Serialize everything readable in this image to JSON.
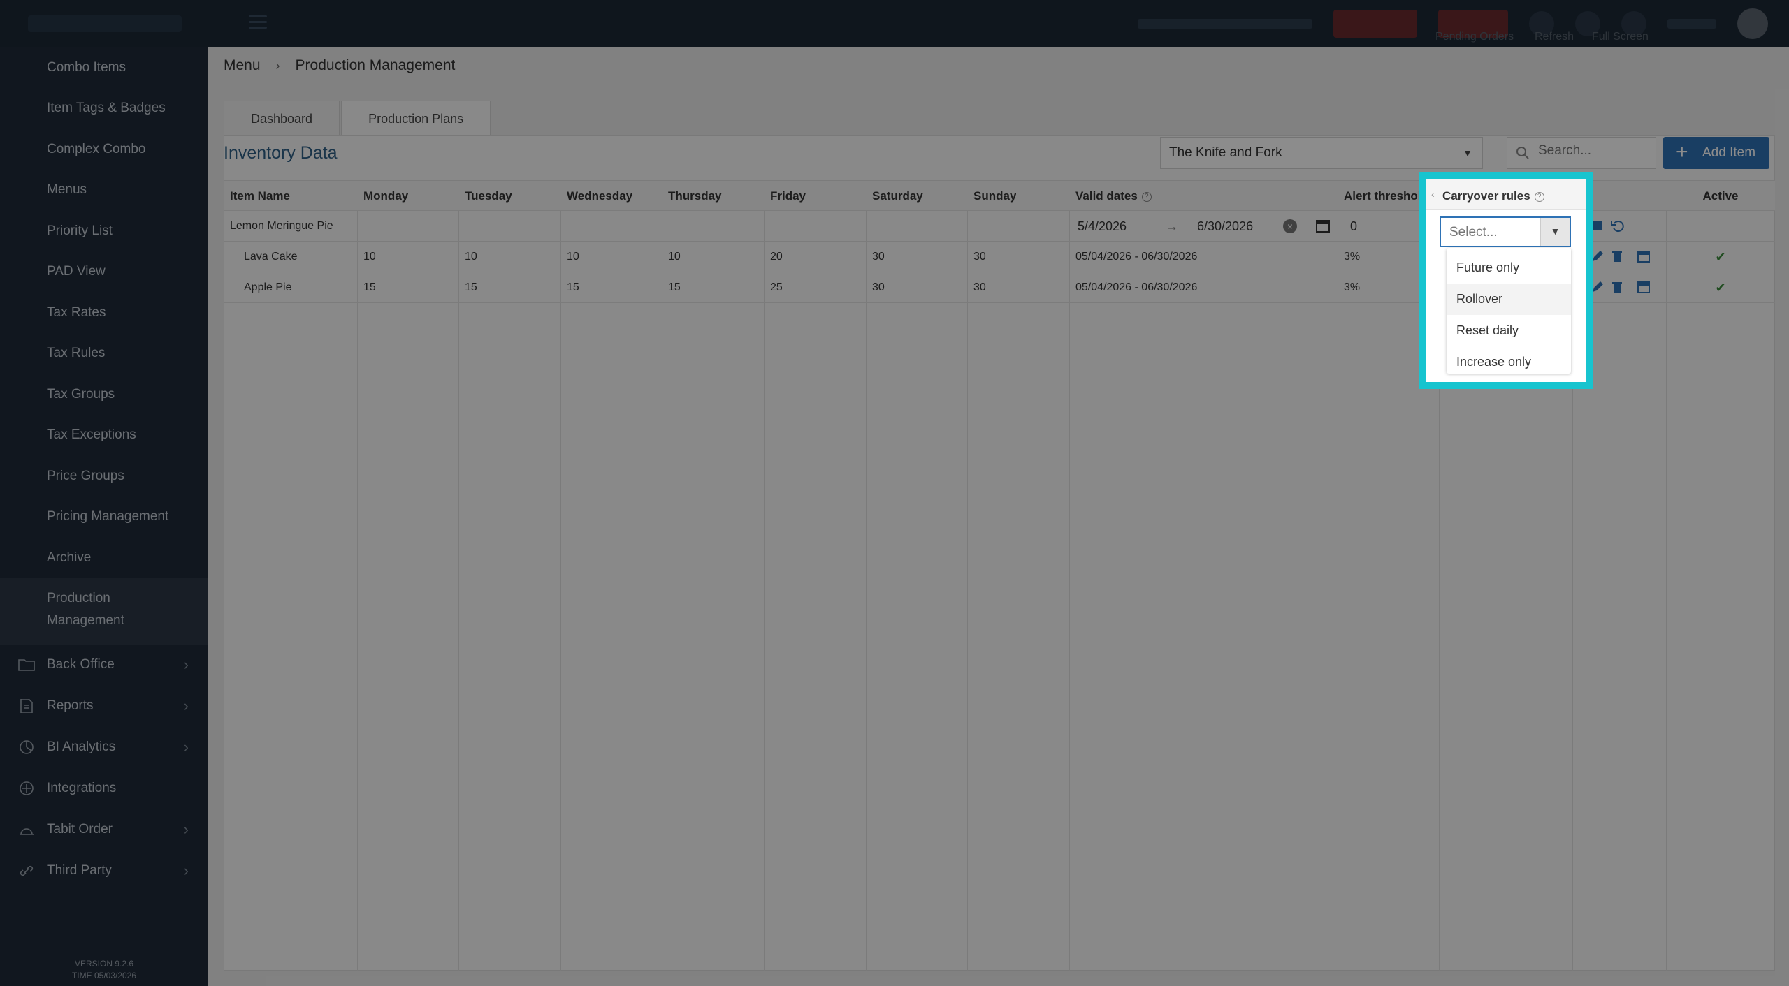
{
  "breadcrumb": {
    "root": "Menu",
    "current": "Production Management"
  },
  "sidebar": {
    "items": [
      "Combo Items",
      "Item Tags & Badges",
      "Complex Combo",
      "Menus",
      "Priority List",
      "PAD View",
      "Tax Rates",
      "Tax Rules",
      "Tax Groups",
      "Tax Exceptions",
      "Price Groups",
      "Pricing Management",
      "Archive"
    ],
    "active": "Production Management",
    "groups": [
      "Back Office",
      "Reports",
      "BI Analytics",
      "Integrations",
      "Tabit Order",
      "Third Party"
    ],
    "version": "VERSION 9.2.6",
    "time": "TIME 05/03/2026"
  },
  "top_right": {
    "labels": [
      "Pending Orders",
      "Refresh",
      "Full Screen"
    ]
  },
  "tabs": [
    "Dashboard",
    "Production Plans"
  ],
  "panel": {
    "title": "Inventory Data",
    "location": "The Knife and Fork",
    "search_placeholder": "Search...",
    "add_button": "Add Item"
  },
  "table": {
    "headers": [
      "Item Name",
      "Monday",
      "Tuesday",
      "Wednesday",
      "Thursday",
      "Friday",
      "Saturday",
      "Sunday",
      "Valid dates",
      "Alert threshold",
      "Carryover rules",
      "",
      "Active"
    ],
    "edit_row": {
      "name": "Lemon Meringue Pie",
      "date_from": "5/4/2026",
      "date_to": "6/30/2026",
      "threshold": "0"
    },
    "rows": [
      {
        "name": "Lava Cake",
        "mon": "10",
        "tue": "10",
        "wed": "10",
        "thu": "10",
        "fri": "20",
        "sat": "30",
        "sun": "30",
        "dates": "05/04/2026 - 06/30/2026",
        "threshold": "3%",
        "active": "✔"
      },
      {
        "name": "Apple Pie",
        "mon": "15",
        "tue": "15",
        "wed": "15",
        "thu": "15",
        "fri": "25",
        "sat": "30",
        "sun": "30",
        "dates": "05/04/2026 - 06/30/2026",
        "threshold": "3%",
        "active": "✔"
      }
    ]
  },
  "carryover": {
    "header": "Carryover rules",
    "placeholder": "Select...",
    "options": [
      "Future only",
      "Rollover",
      "Reset daily",
      "Increase only"
    ],
    "hovered": "Rollover"
  },
  "colors": {
    "accent": "#2e72b5",
    "highlight": "#17c4cf",
    "sidebar": "#1f2b39"
  }
}
